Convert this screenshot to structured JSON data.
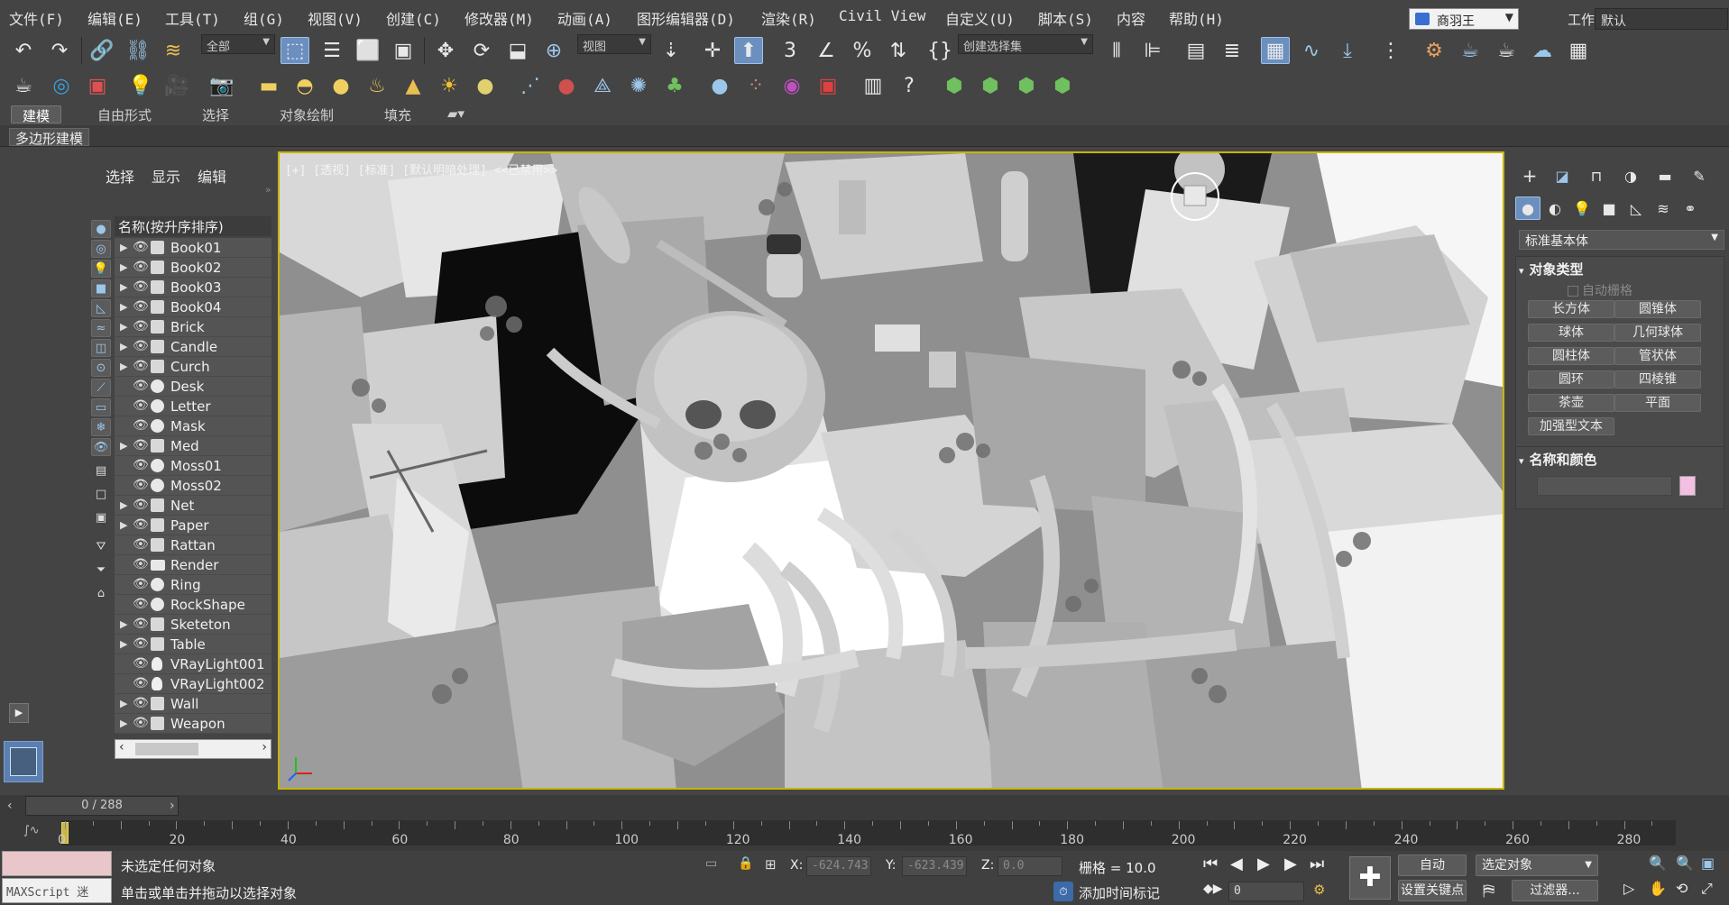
{
  "menu": [
    "文件(F)",
    "编辑(E)",
    "工具(T)",
    "组(G)",
    "视图(V)",
    "创建(C)",
    "修改器(M)",
    "动画(A)",
    "图形编辑器(D)",
    "渲染(R)",
    "Civil View",
    "自定义(U)",
    "脚本(S)",
    "内容",
    "帮助(H)"
  ],
  "user": "商羽王",
  "workspace": {
    "label": "工作区:",
    "value": "默认"
  },
  "toolbar": {
    "filter_select": "全部",
    "ref_coord_select": "视图",
    "selection_set_select": "创建选择集"
  },
  "ribbon": {
    "tabs": [
      "建模",
      "自由形式",
      "选择",
      "对象绘制",
      "填充"
    ],
    "panel_label": "多边形建模"
  },
  "scene_explorer": {
    "tabs": [
      "选择",
      "显示",
      "编辑"
    ],
    "header": "名称(按升序排序)",
    "items": [
      {
        "name": "Book01",
        "type": "geo",
        "expand": true
      },
      {
        "name": "Book02",
        "type": "geo",
        "expand": true
      },
      {
        "name": "Book03",
        "type": "geo",
        "expand": true
      },
      {
        "name": "Book04",
        "type": "geo",
        "expand": true
      },
      {
        "name": "Brick",
        "type": "geo",
        "expand": true
      },
      {
        "name": "Candle",
        "type": "geo",
        "expand": true
      },
      {
        "name": "Curch",
        "type": "geo",
        "expand": true
      },
      {
        "name": "Desk",
        "type": "sphere",
        "expand": false
      },
      {
        "name": "Letter",
        "type": "sphere",
        "expand": false
      },
      {
        "name": "Mask",
        "type": "sphere",
        "expand": false
      },
      {
        "name": "Med",
        "type": "geo",
        "expand": true
      },
      {
        "name": "Moss01",
        "type": "sphere",
        "expand": false
      },
      {
        "name": "Moss02",
        "type": "sphere",
        "expand": false
      },
      {
        "name": "Net",
        "type": "geo",
        "expand": true
      },
      {
        "name": "Paper",
        "type": "geo",
        "expand": true
      },
      {
        "name": "Rattan",
        "type": "geo",
        "expand": false
      },
      {
        "name": "Render",
        "type": "camera",
        "expand": false
      },
      {
        "name": "Ring",
        "type": "sphere",
        "expand": false
      },
      {
        "name": "RockShape",
        "type": "sphere",
        "expand": false
      },
      {
        "name": "Sketeton",
        "type": "geo",
        "expand": true
      },
      {
        "name": "Table",
        "type": "geo",
        "expand": true
      },
      {
        "name": "VRayLight001",
        "type": "light",
        "expand": false
      },
      {
        "name": "VRayLight002",
        "type": "light",
        "expand": false
      },
      {
        "name": "Wall",
        "type": "geo",
        "expand": true
      },
      {
        "name": "Weapon",
        "type": "geo",
        "expand": true
      }
    ]
  },
  "viewport": {
    "label": "[+] [透视] [标准] [默认明暗处理] <<已禁用>>"
  },
  "command_panel": {
    "category_select": "标准基本体",
    "object_type_title": "对象类型",
    "autogrid": "自动栅格",
    "buttons": [
      "长方体",
      "圆锥体",
      "球体",
      "几何球体",
      "圆柱体",
      "管状体",
      "圆环",
      "四棱锥",
      "茶壶",
      "平面",
      "加强型文本"
    ],
    "name_color_title": "名称和颜色"
  },
  "timeline": {
    "frame_display": "0 / 288",
    "ticks": [
      "0",
      "20",
      "40",
      "60",
      "80",
      "100",
      "120",
      "140",
      "160",
      "180",
      "200",
      "220",
      "240",
      "260",
      "280"
    ]
  },
  "status": {
    "maxscript": "MAXScript 迷",
    "line1": "未选定任何对象",
    "line2": "单击或单击并拖动以选择对象",
    "x_label": "X:",
    "x_value": "-624.743",
    "y_label": "Y:",
    "y_value": "-623.439",
    "z_label": "Z:",
    "z_value": "0.0",
    "grid": "栅格 = 10.0",
    "add_time_tag": "添加时间标记",
    "auto_key": "自动",
    "set_key": "设置关键点",
    "selected_object": "选定对象",
    "filters": "过滤器...",
    "frame_input": "0"
  }
}
